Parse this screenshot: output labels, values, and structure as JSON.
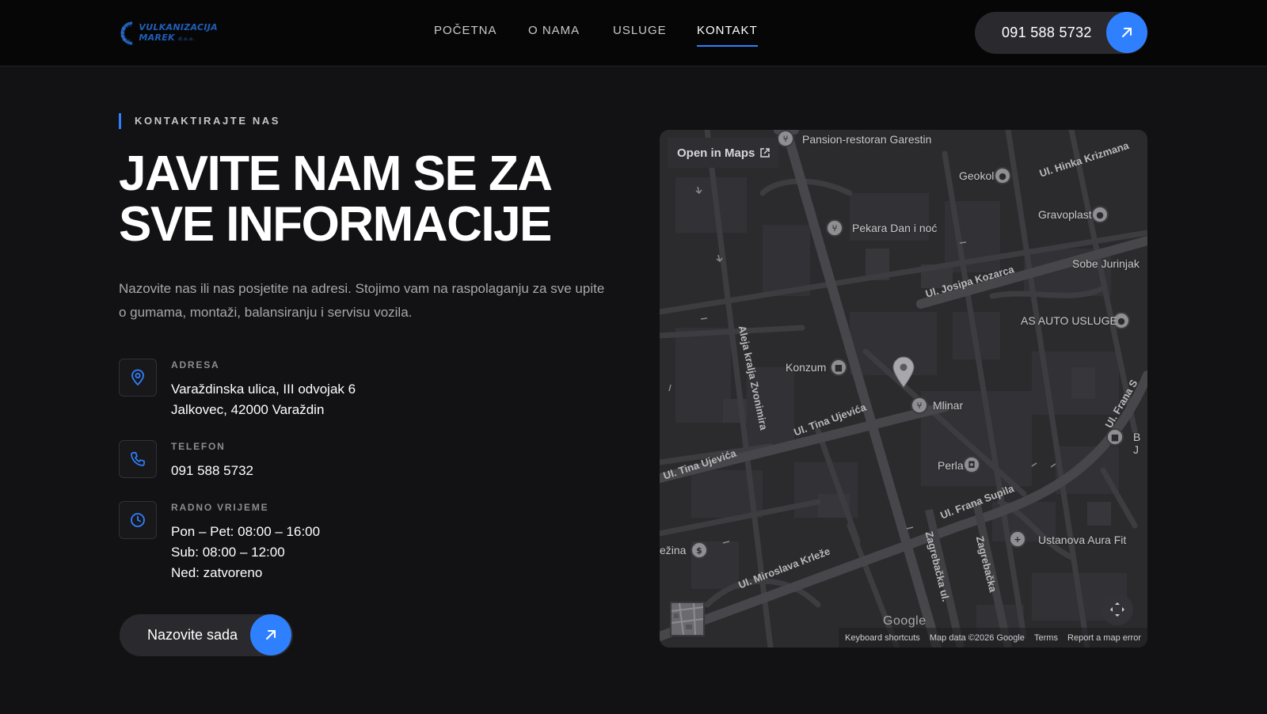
{
  "brand": {
    "name_line1": "VULKANIZACIJA",
    "name_line2": "MAREK",
    "name_suffix": "d.o.o."
  },
  "nav": {
    "items": [
      {
        "label": "POČETNA"
      },
      {
        "label": "O NAMA"
      },
      {
        "label": "USLUGE"
      },
      {
        "label": "KONTAKT",
        "active": true
      }
    ]
  },
  "header_phone": {
    "label": "091 588 5732",
    "icon": "arrow-up-right-icon"
  },
  "eyebrow": "KONTAKTIRAJTE NAS",
  "headline": {
    "line1": "JAVITE NAM SE ZA",
    "line2": "SVE INFORMACIJE"
  },
  "intro": "Nazovite nas ili nas posjetite na adresi. Stojimo vam na raspolaganju za sve upite o gumama, montaži, balansiranju i servisu vozila.",
  "contact": {
    "address": {
      "title": "ADRESA",
      "icon": "map-pin-icon",
      "line1": "Varaždinska ulica, III odvojak 6",
      "line2": "Jalkovec, 42000 Varaždin"
    },
    "phone": {
      "title": "TELEFON",
      "icon": "phone-icon",
      "line1": "091 588 5732"
    },
    "hours": {
      "title": "RADNO VRIJEME",
      "icon": "clock-icon",
      "line1": "Pon – Pet: 08:00 – 16:00",
      "line2": "Sub: 08:00 – 12:00",
      "line3": "Ned: zatvoreno"
    }
  },
  "cta": {
    "label": "Nazovite sada",
    "icon": "arrow-up-right-icon"
  },
  "map": {
    "open_in_maps": "Open in Maps",
    "places": {
      "p1": "Pansion-restoran Garestin",
      "p2": "Geokol",
      "p3": "Ul. Hinka Krizmana",
      "p4": "Gravoplast",
      "p5": "Pekara Dan i noć",
      "p6": "Sobe Jurinjak",
      "p7": "Ul. Josipa Kozarca",
      "p8": "AS AUTO USLUGE",
      "p9": "Aleja kralja Zvonimira",
      "p10": "Konzum",
      "p11": "Mlinar",
      "p12": "Ul. Tina Ujevića",
      "p13": "Ul. Tina Ujevića",
      "p14": "Perla",
      "p15": "Ul. Frana Supila",
      "p16": "Ul. Frana S",
      "p17": "Ustanova Aura Fit",
      "p18": "ežina",
      "p19": "Ul. Miroslava Krleže",
      "p20": "Zagrebačka ul.",
      "p21": "Zagrebačka",
      "p22": "B",
      "p23": "J"
    },
    "google": "Google",
    "attribution": {
      "shortcuts": "Keyboard shortcuts",
      "data": "Map data ©2026 Google",
      "terms": "Terms",
      "report": "Report a map error"
    }
  },
  "colors": {
    "accent": "#2f80ff",
    "background": "#121214",
    "header": "#060607",
    "pill": "#2a2a2e",
    "map": "#2b2b2e"
  }
}
